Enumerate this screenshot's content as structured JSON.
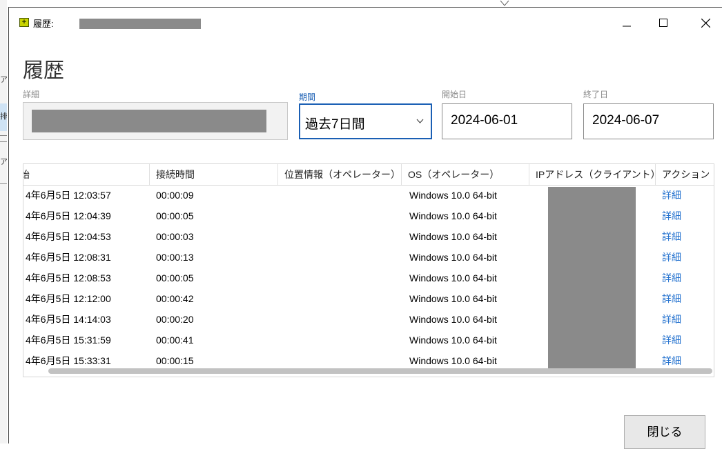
{
  "window": {
    "title": "履歴:",
    "heading": "履歴"
  },
  "filters": {
    "detail_label": "詳細",
    "period_label": "期間",
    "period_value": "過去7日間",
    "start_label": "開始日",
    "start_value": "2024-06-01",
    "end_label": "終了日",
    "end_value": "2024-06-07"
  },
  "table": {
    "columns": [
      "始",
      "接続時間",
      "位置情報（オペレーター）",
      "OS（オペレーター）",
      "IPアドレス（クライアント）",
      "アクション"
    ],
    "rows": [
      {
        "start": "4年6月5日 12:03:57",
        "duration": "00:00:09",
        "location": "",
        "os": "Windows 10.0 64-bit",
        "action": "詳細"
      },
      {
        "start": "4年6月5日 12:04:39",
        "duration": "00:00:05",
        "location": "",
        "os": "Windows 10.0 64-bit",
        "action": "詳細"
      },
      {
        "start": "4年6月5日 12:04:53",
        "duration": "00:00:03",
        "location": "",
        "os": "Windows 10.0 64-bit",
        "action": "詳細"
      },
      {
        "start": "4年6月5日 12:08:31",
        "duration": "00:00:13",
        "location": "",
        "os": "Windows 10.0 64-bit",
        "action": "詳細"
      },
      {
        "start": "4年6月5日 12:08:53",
        "duration": "00:00:05",
        "location": "",
        "os": "Windows 10.0 64-bit",
        "action": "詳細"
      },
      {
        "start": "4年6月5日 12:12:00",
        "duration": "00:00:42",
        "location": "",
        "os": "Windows 10.0 64-bit",
        "action": "詳細"
      },
      {
        "start": "4年6月5日 14:14:03",
        "duration": "00:00:20",
        "location": "",
        "os": "Windows 10.0 64-bit",
        "action": "詳細"
      },
      {
        "start": "4年6月5日 15:31:59",
        "duration": "00:00:41",
        "location": "",
        "os": "Windows 10.0 64-bit",
        "action": "詳細"
      },
      {
        "start": "4年6月5日 15:33:31",
        "duration": "00:00:15",
        "location": "",
        "os": "Windows 10.0 64-bit",
        "action": "詳細"
      }
    ]
  },
  "footer": {
    "close_label": "閉じる"
  },
  "background": {
    "fragments": [
      "ア",
      "排",
      "ア"
    ]
  },
  "colors": {
    "accent": "#1a5fb4",
    "link": "#1f6fce",
    "redaction": "#8a8a8a"
  },
  "icons": {
    "app": "monitor-plus-icon",
    "minimize": "minimize-icon",
    "maximize": "maximize-icon",
    "close": "close-icon",
    "dropdown": "chevron-down-icon"
  }
}
